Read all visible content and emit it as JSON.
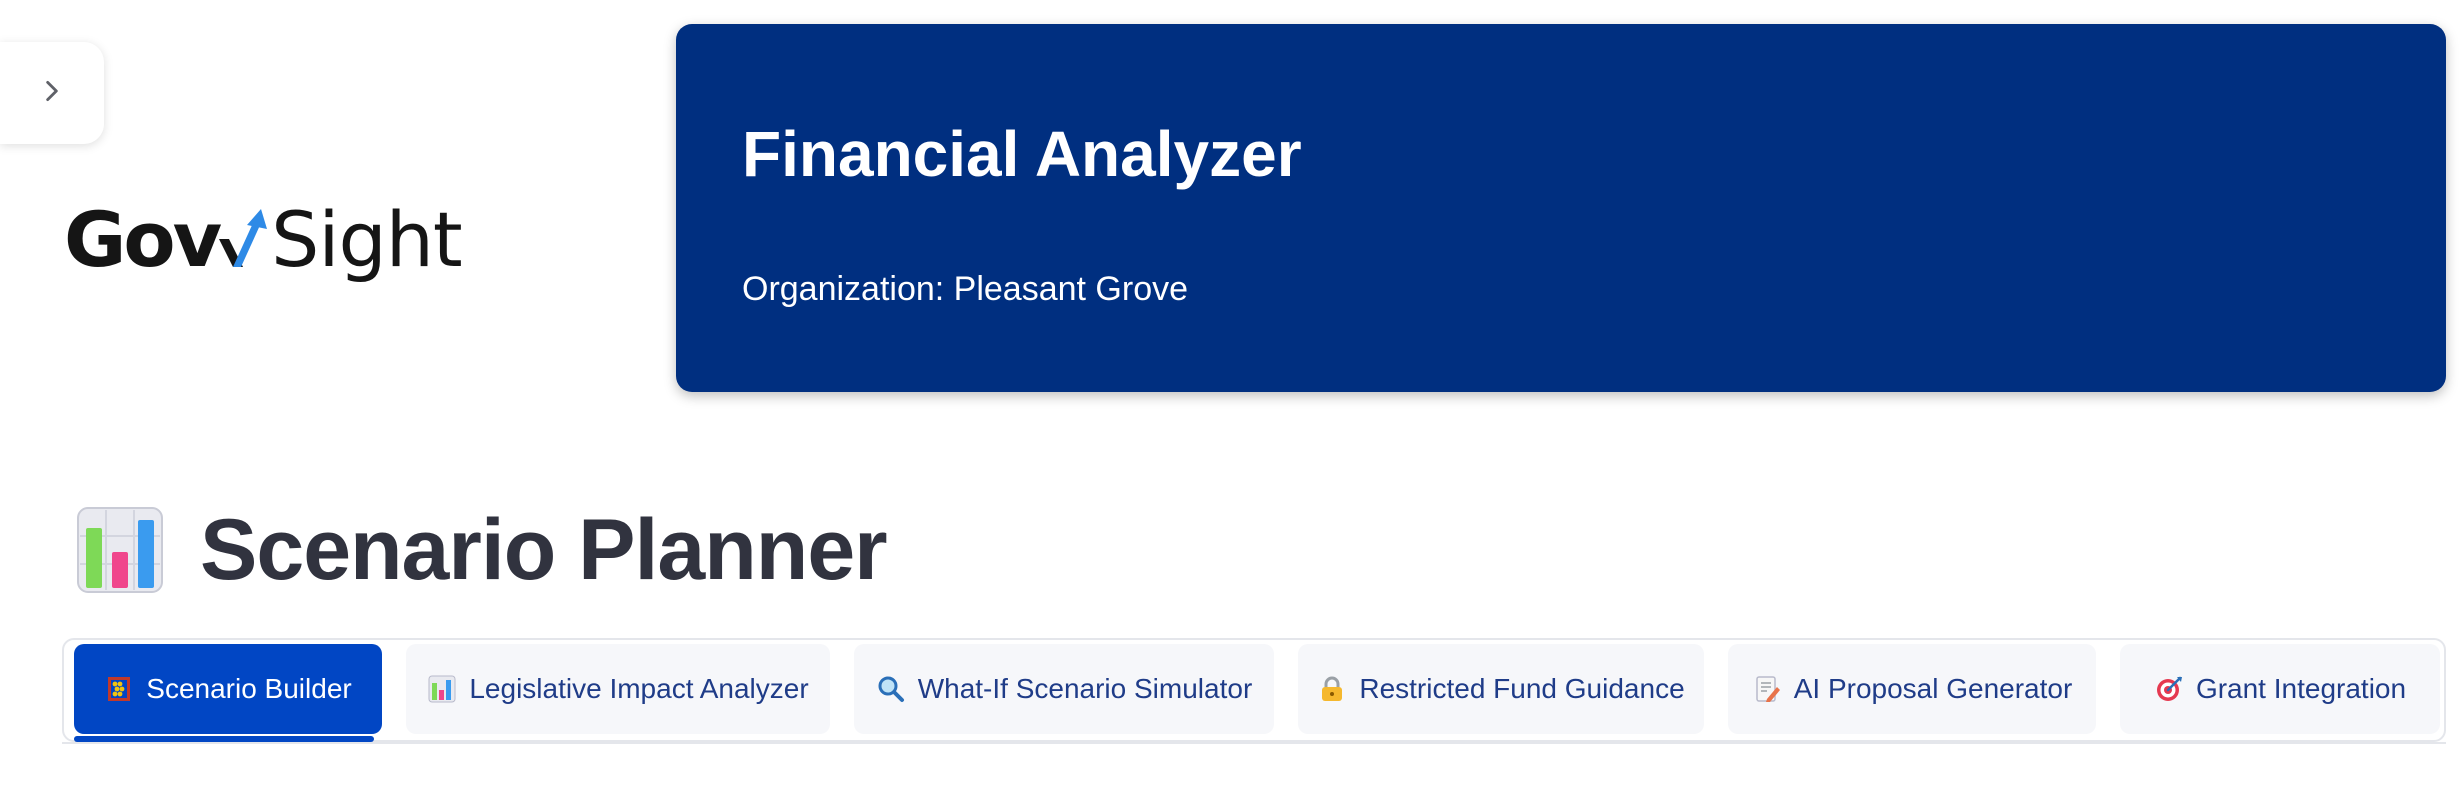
{
  "sidebar": {
    "toggle_icon": "chevron-right-icon"
  },
  "logo": {
    "text_bold": "Gov",
    "text_light": "Sight",
    "mark_icon": "check-arrow-icon"
  },
  "header": {
    "title": "Financial Analyzer",
    "organization": "Organization: Pleasant Grove",
    "background": "#002F80"
  },
  "page": {
    "heading_icon": "bar-chart-icon",
    "heading": "Scenario Planner"
  },
  "tabs": [
    {
      "label": "Scenario Builder",
      "icon": "abacus-icon",
      "active": true
    },
    {
      "label": "Legislative Impact Analyzer",
      "icon": "bar-chart-icon",
      "active": false
    },
    {
      "label": "What-If Scenario Simulator",
      "icon": "magnifier-icon",
      "active": false
    },
    {
      "label": "Restricted Fund Guidance",
      "icon": "lock-icon",
      "active": false
    },
    {
      "label": "AI Proposal Generator",
      "icon": "memo-icon",
      "active": false
    },
    {
      "label": "Grant Integration",
      "icon": "target-icon",
      "active": false
    }
  ],
  "colors": {
    "accent": "#0146C4",
    "tab_text": "#1F3C88",
    "heading_text": "#31333F"
  }
}
